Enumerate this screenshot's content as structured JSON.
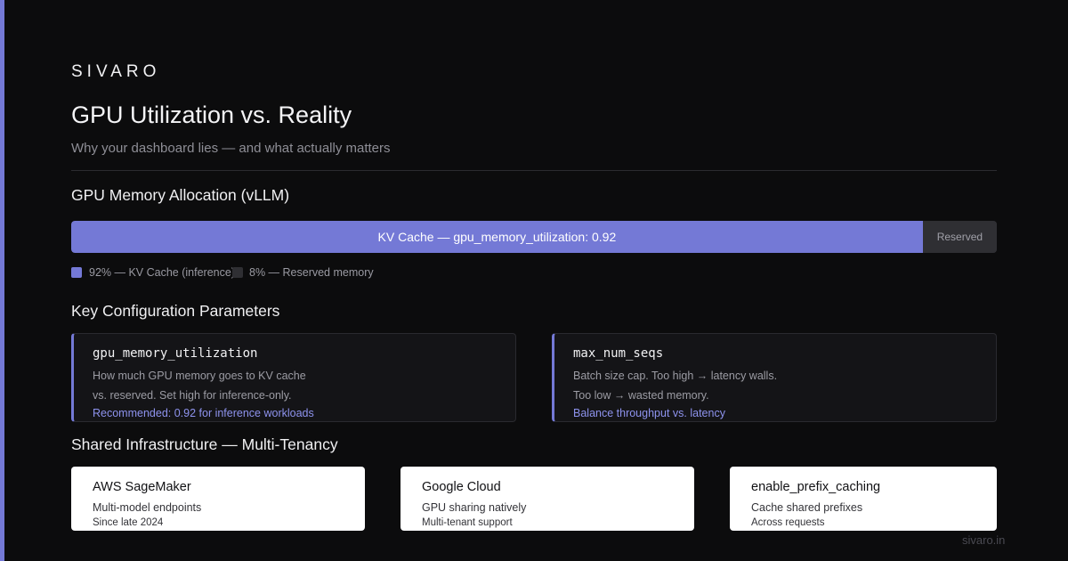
{
  "brand": "SIVARO",
  "title": "GPU Utilization vs. Reality",
  "subtitle": "Why your dashboard lies — and what actually matters",
  "memory": {
    "heading": "GPU Memory Allocation (vLLM)",
    "kv_fraction": 0.92,
    "kv_label": "KV Cache — gpu_memory_utilization: 0.92",
    "reserved_label": "Reserved",
    "legend_kv": "92% — KV Cache (inference)",
    "legend_reserved": "8% — Reserved memory",
    "colors": {
      "kv": "#7479d6",
      "reserved": "#2f2f33"
    }
  },
  "params": {
    "heading": "Key Configuration Parameters",
    "items": [
      {
        "name": "gpu_memory_utilization",
        "desc1": "How much GPU memory goes to KV cache",
        "desc2": "vs. reserved. Set high for inference-only.",
        "rec": "Recommended: 0.92 for inference workloads"
      },
      {
        "name": "max_num_seqs",
        "desc1": "Batch size cap. Too high → latency walls.",
        "desc2": "Too low → wasted memory.",
        "rec": "Balance throughput vs. latency"
      }
    ]
  },
  "infra": {
    "heading": "Shared Infrastructure — Multi-Tenancy",
    "items": [
      {
        "title": "AWS SageMaker",
        "line1": "Multi-model endpoints",
        "line2": "Since late 2024"
      },
      {
        "title": "Google Cloud",
        "line1": "GPU sharing natively",
        "line2": "Multi-tenant support"
      },
      {
        "title": "enable_prefix_caching",
        "line1": "Cache shared prefixes",
        "line2": "Across requests"
      }
    ]
  },
  "footer": "sivaro.in",
  "accent_color": "#7479d6"
}
